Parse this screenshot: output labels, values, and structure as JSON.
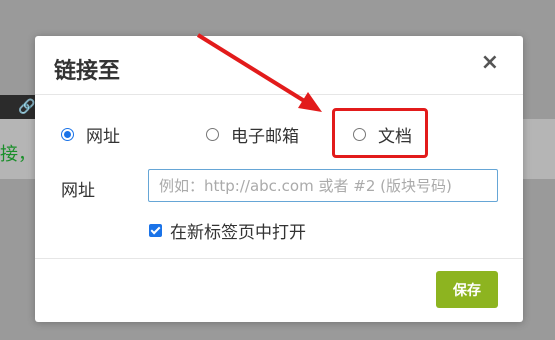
{
  "background": {
    "partial_text": "接，"
  },
  "dialog": {
    "title": "链接至",
    "close_glyph": "×",
    "link_types": [
      {
        "label": "网址",
        "checked": true
      },
      {
        "label": "电子邮箱",
        "checked": false
      },
      {
        "label": "文档",
        "checked": false
      }
    ],
    "url_label": "网址",
    "url_value": "",
    "url_placeholder": "例如：http://abc.com 或者 #2 (版块号码)",
    "open_new_tab_label": "在新标签页中打开",
    "open_new_tab_checked": true,
    "save_label": "保存"
  },
  "colors": {
    "accent": "#1a73e8",
    "save_button": "#8db420",
    "annotation": "#e21b1b"
  }
}
